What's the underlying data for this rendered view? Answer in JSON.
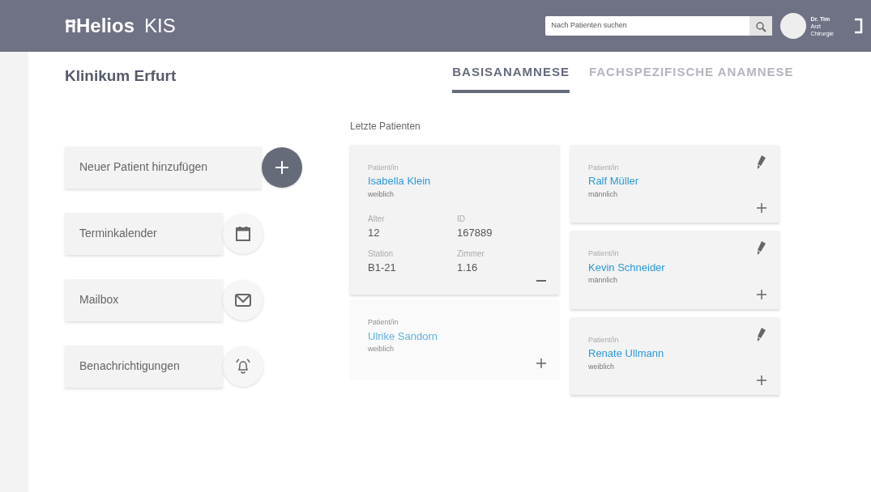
{
  "header": {
    "logo": "Helios",
    "product": "KIS",
    "search": {
      "placeholder": "Nach Patienten suchen"
    },
    "user": [
      "Dr. Tim",
      "Arzt",
      "Chirurgie"
    ]
  },
  "hospital": "Klinikum Erfurt",
  "tabs": [
    {
      "label": "BASISANAMNESE",
      "selected": true
    },
    {
      "label": "FACHSPEZIFISCHE ANAMNESE",
      "selected": false
    }
  ],
  "actions": [
    {
      "label": "Neuer Patient hinzufügen",
      "kind": "add"
    },
    {
      "label": "Terminkalender",
      "kind": "calendar"
    },
    {
      "label": "Mailbox",
      "kind": "mail"
    },
    {
      "label": "Benachrichtigungen",
      "kind": "notification"
    }
  ],
  "recent_title": "Letzte Patienten",
  "patient_columns": [
    [
      {
        "label": "Patient/in",
        "name": "Isabella Klein",
        "gender": "weiblich",
        "expanded": true,
        "inactive": false,
        "editable": false,
        "details": [
          {
            "label": "Alter",
            "value": "12"
          },
          {
            "label": "ID",
            "value": "167889"
          },
          {
            "label": "Station",
            "value": "B1-21"
          },
          {
            "label": "Zimmer",
            "value": "1.16"
          }
        ]
      },
      {
        "label": "Patient/in",
        "name": "Ulrike Sandorn",
        "gender": "weiblich",
        "expanded": false,
        "inactive": true,
        "editable": false
      }
    ],
    [
      {
        "label": "Patient/in",
        "name": "Ralf Müller",
        "gender": "männlich",
        "expanded": false,
        "inactive": false,
        "editable": true
      },
      {
        "label": "Patient/in",
        "name": "Kevin Schneider",
        "gender": "männlich",
        "expanded": false,
        "inactive": false,
        "editable": true
      },
      {
        "label": "Patient/in",
        "name": "Renate Ullmann",
        "gender": "weiblich",
        "expanded": false,
        "inactive": false,
        "editable": true
      }
    ]
  ]
}
